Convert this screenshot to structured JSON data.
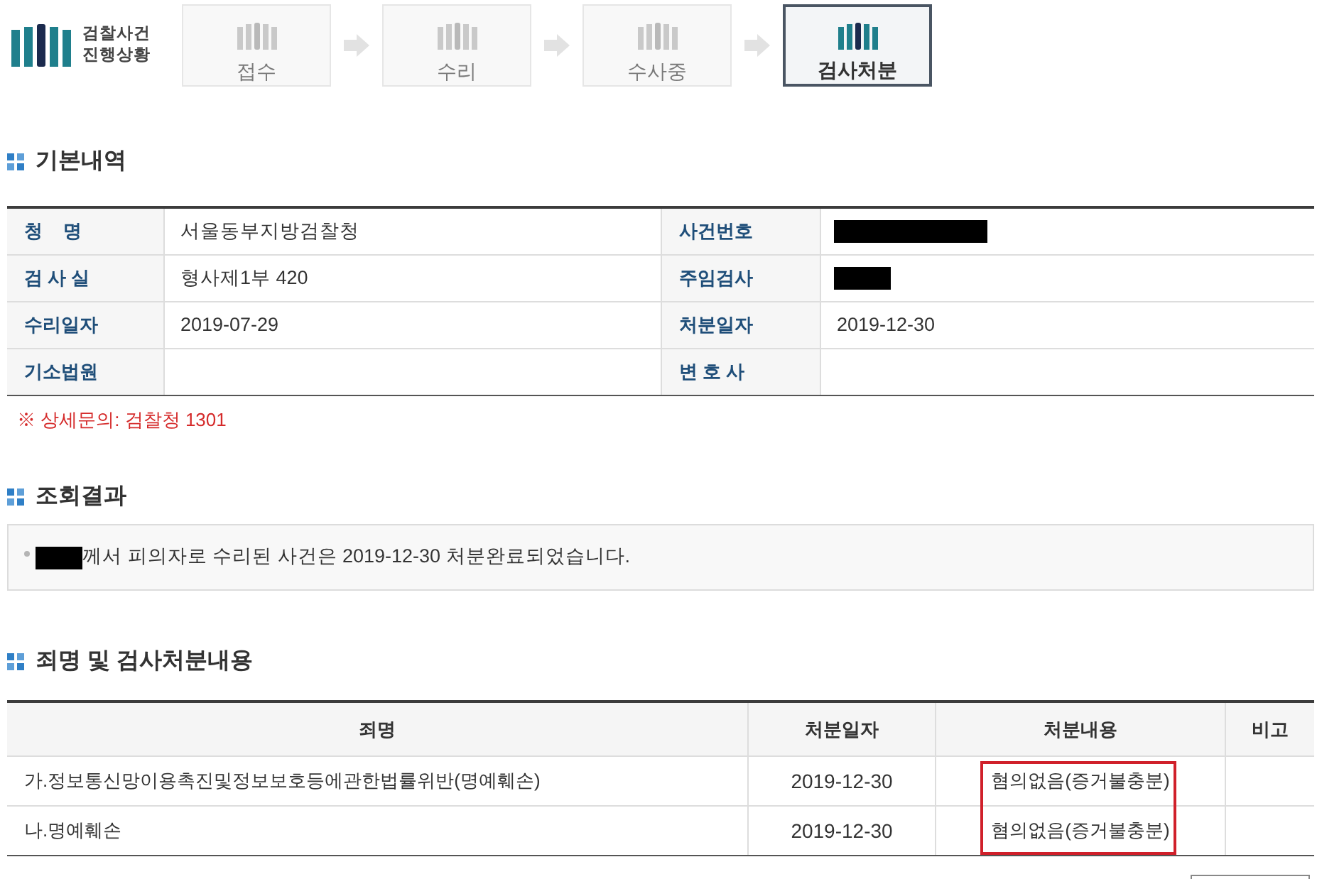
{
  "header": {
    "logo": {
      "lines": [
        "검찰사건",
        "진행상황"
      ]
    },
    "steps": [
      {
        "label": "접수",
        "selected": false
      },
      {
        "label": "수리",
        "selected": false
      },
      {
        "label": "수사중",
        "selected": false
      },
      {
        "label": "검사처분",
        "selected": true
      }
    ]
  },
  "basic_info": {
    "title": "기본내역",
    "fields": [
      {
        "label": "청    명",
        "value": "서울동부지방검찰청",
        "redacted": false
      },
      {
        "label": "사건번호",
        "redacted": true
      },
      {
        "label": "검 사 실",
        "value": "형사제1부 420",
        "redacted": false
      },
      {
        "label": "주임검사",
        "redacted": true
      },
      {
        "label": "수리일자",
        "value": "2019-07-29",
        "redacted": false
      },
      {
        "label": "처분일자",
        "value": "2019-12-30",
        "redacted": false
      },
      {
        "label": "기소법원",
        "redacted": false
      },
      {
        "label": "변 호 사",
        "redacted": false
      }
    ],
    "note": "※ 상세문의: 검찰청 1301"
  },
  "result": {
    "title": "조회결과",
    "message": {
      "name_redacted": true,
      "text": "께서 피의자로 수리된 사건은 2019-12-30 처분완료되었습니다."
    }
  },
  "charges": {
    "title": "죄명 및 검사처분내용",
    "columns": [
      "죄명",
      "처분일자",
      "처분내용",
      "비고"
    ],
    "rows": [
      {
        "charge": "가.정보통신망이용촉진및정보보호등에관한법률위반(명예훼손)",
        "date": "2019-12-30",
        "disposition": "혐의없음(증거불충분)"
      },
      {
        "charge": "나.명예훼손",
        "date": "2019-12-30",
        "disposition": "혐의없음(증거불충분)"
      }
    ],
    "highlight": true
  }
}
